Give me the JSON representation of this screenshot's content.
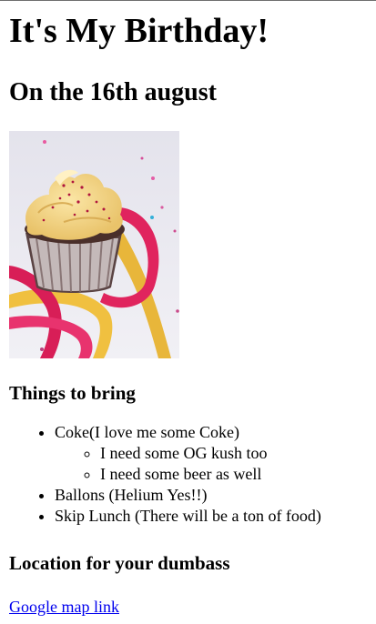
{
  "page": {
    "title": "It's My Birthday!",
    "subtitle": "On the 16th august",
    "image_alt": "Cupcake with yellow frosting and ribbons",
    "things_heading": "Things to bring",
    "things": [
      {
        "label": "Coke(I love me some Coke)"
      },
      {
        "label": "Ballons (Helium Yes!!)"
      },
      {
        "label": "Skip Lunch (There will be a ton of food)"
      }
    ],
    "coke_subitems": [
      "I need some OG kush too",
      "I need some beer as well"
    ],
    "location_heading": "Location for your dumbass",
    "map_link_text": "Google map link"
  },
  "colors": {
    "link": "#0000ee",
    "text": "#000000",
    "background": "#ffffff"
  }
}
